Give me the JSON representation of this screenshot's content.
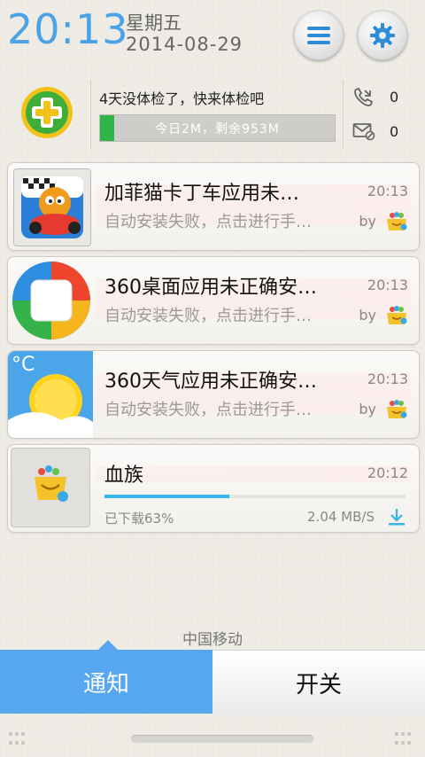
{
  "header": {
    "time": "20:13",
    "weekday": "星期五",
    "date": "2014-08-29",
    "accent_color": "#4aa3e6"
  },
  "status_panel": {
    "message": "4天没体检了，快来体检吧",
    "storage_label": "今日2M，剩余953M",
    "storage_used_fraction": 0.06,
    "missed_calls": "0",
    "unread_sms": "0"
  },
  "notifications": [
    {
      "title": "加菲猫卡丁车应用未…",
      "time": "20:13",
      "subtitle": "自动安装失败，点击进行手…",
      "by": "by",
      "icon": "garfield-kart-app-icon"
    },
    {
      "title": "360桌面应用未正确安…",
      "time": "20:13",
      "subtitle": "自动安装失败，点击进行手…",
      "by": "by",
      "icon": "360-launcher-app-icon"
    },
    {
      "title": "360天气应用未正确安…",
      "time": "20:13",
      "subtitle": "自动安装失败，点击进行手…",
      "by": "by",
      "icon": "360-weather-app-icon"
    }
  ],
  "download": {
    "title": "血族",
    "time": "20:12",
    "progress_text": "已下载63%",
    "progress": 0.63,
    "speed": "2.04 MB/S",
    "progress_color": "#35b6e8"
  },
  "carrier": "中国移动",
  "tabs": {
    "notify": "通知",
    "switch": "开关"
  }
}
